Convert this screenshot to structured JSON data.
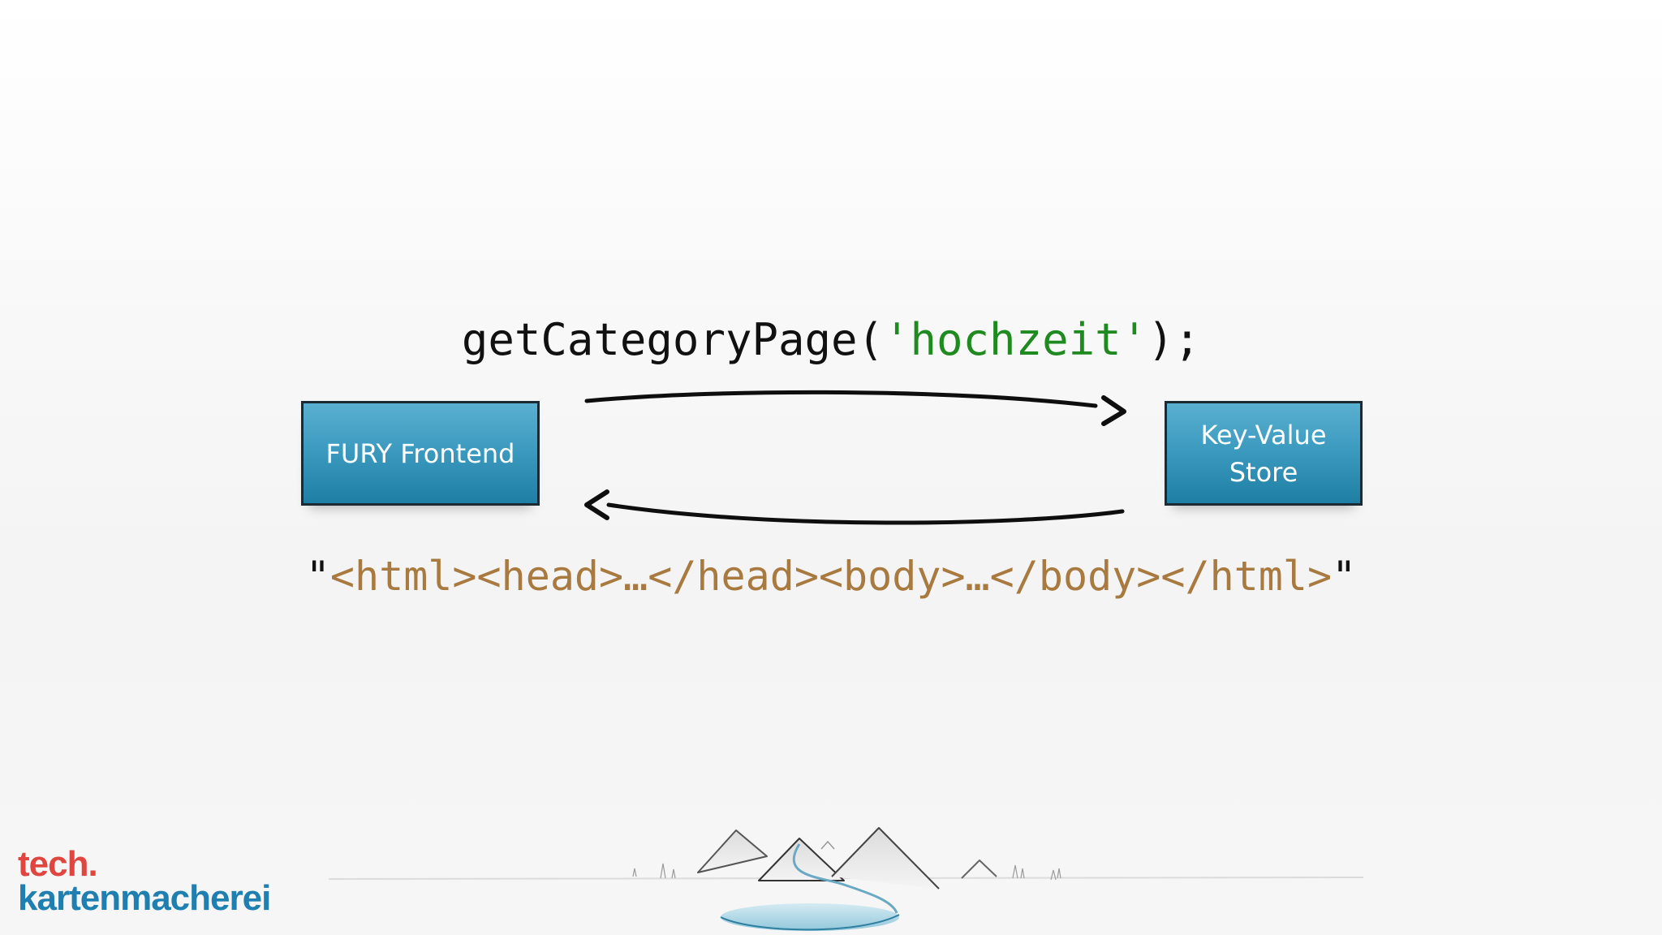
{
  "request": {
    "prefix": "getCategoryPage(",
    "argument": "'hochzeit'",
    "suffix": ");"
  },
  "response": {
    "open_quote": "\"",
    "html": "<html><head>…</head><body>…</body></html>",
    "close_quote": "\""
  },
  "nodes": {
    "frontend": "FURY Frontend",
    "store": "Key-Value\nStore"
  },
  "logo": {
    "line1": "tech.",
    "line2": "kartenmacherei"
  },
  "colors": {
    "box_fill": "#3d9bc0",
    "string_green": "#1f8a1f",
    "html_tan": "#a97a3f",
    "logo_red": "#e0453f",
    "logo_blue": "#1f7fb0"
  }
}
